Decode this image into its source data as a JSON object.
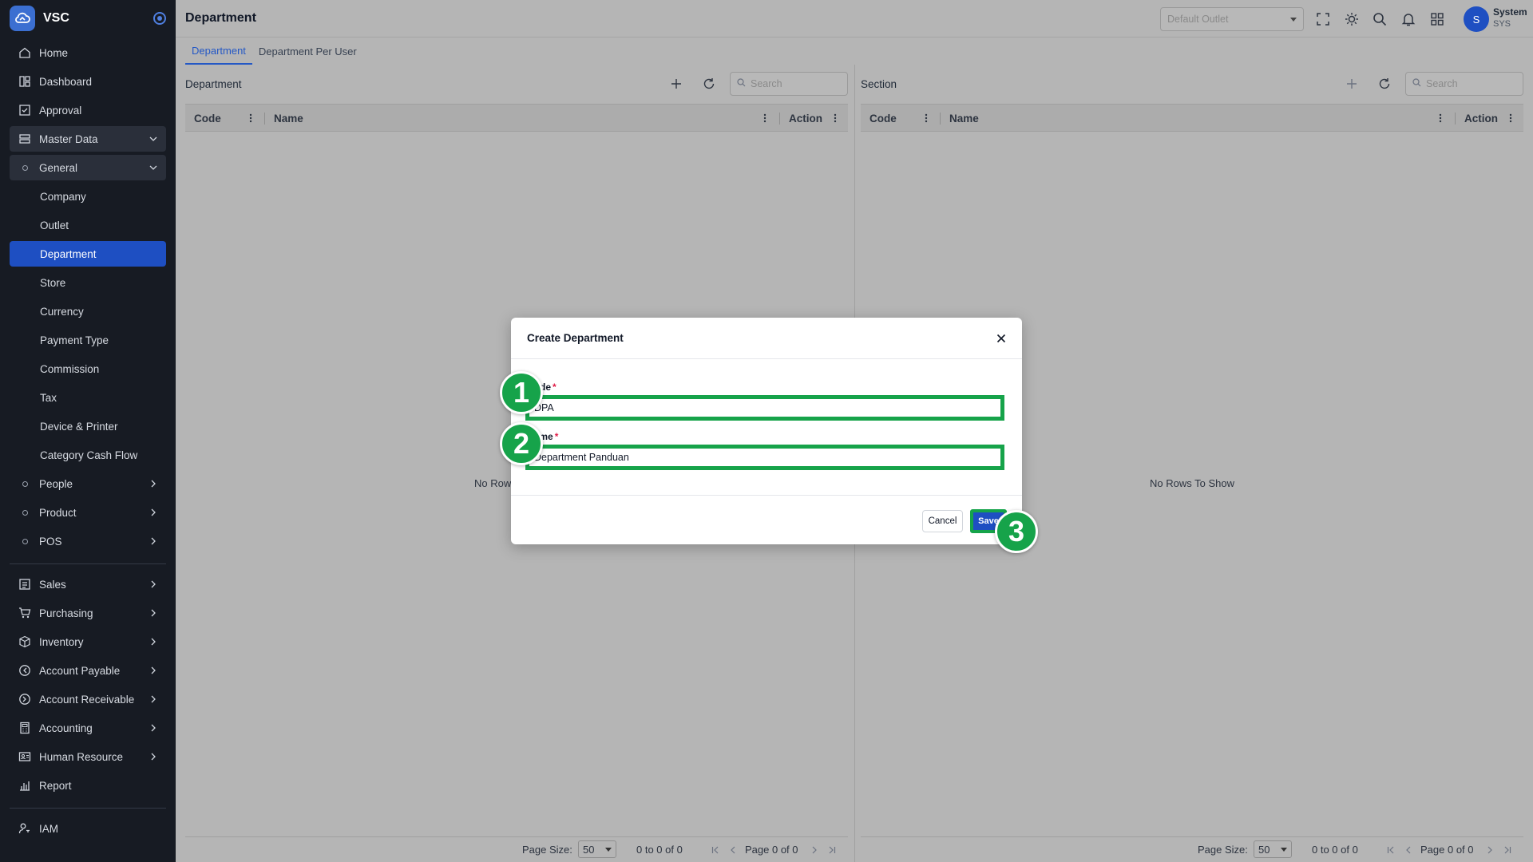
{
  "app": {
    "name": "VSC"
  },
  "sidebar": {
    "items": [
      {
        "label": "Home",
        "icon": "home-icon"
      },
      {
        "label": "Dashboard",
        "icon": "dashboard-icon"
      },
      {
        "label": "Approval",
        "icon": "approval-icon"
      },
      {
        "label": "Master Data",
        "icon": "master-data-icon"
      },
      {
        "label": "General"
      },
      {
        "label": "Company"
      },
      {
        "label": "Outlet"
      },
      {
        "label": "Department"
      },
      {
        "label": "Store"
      },
      {
        "label": "Currency"
      },
      {
        "label": "Payment Type"
      },
      {
        "label": "Commission"
      },
      {
        "label": "Tax"
      },
      {
        "label": "Device & Printer"
      },
      {
        "label": "Category Cash Flow"
      },
      {
        "label": "People"
      },
      {
        "label": "Product"
      },
      {
        "label": "POS"
      },
      {
        "label": "Sales",
        "icon": "sales-icon"
      },
      {
        "label": "Purchasing",
        "icon": "cart-icon"
      },
      {
        "label": "Inventory",
        "icon": "box-icon"
      },
      {
        "label": "Account Payable",
        "icon": "payable-icon"
      },
      {
        "label": "Account Receivable",
        "icon": "receivable-icon"
      },
      {
        "label": "Accounting",
        "icon": "calculator-icon"
      },
      {
        "label": "Human Resource",
        "icon": "id-card-icon"
      },
      {
        "label": "Report",
        "icon": "bar-chart-icon"
      },
      {
        "label": "IAM",
        "icon": "user-key-icon"
      }
    ]
  },
  "header": {
    "title": "Department",
    "outlet_placeholder": "Default Outlet",
    "user": {
      "initial": "S",
      "name": "System",
      "code": "SYS"
    }
  },
  "tabs": [
    {
      "label": "Department",
      "active": true
    },
    {
      "label": "Department Per User",
      "active": false
    }
  ],
  "department_panel": {
    "title": "Department",
    "search_placeholder": "Search",
    "columns": [
      "Code",
      "Name",
      "Action"
    ],
    "empty_text": "No Rows To Show",
    "page_size_label": "Page Size:",
    "page_size": "50",
    "range": "0 to 0 of 0",
    "page": "Page 0 of 0"
  },
  "section_panel": {
    "title": "Section",
    "search_placeholder": "Search",
    "columns": [
      "Code",
      "Name",
      "Action"
    ],
    "empty_text": "No Rows To Show",
    "page_size_label": "Page Size:",
    "page_size": "50",
    "range": "0 to 0 of 0",
    "page": "Page 0 of 0"
  },
  "modal": {
    "title": "Create Department",
    "code_label": "Code",
    "code_value": "DPA",
    "name_label": "Name",
    "name_value": "Department Panduan",
    "required_mark": "*",
    "cancel_label": "Cancel",
    "save_label": "Save"
  },
  "markers": [
    "1",
    "2",
    "3"
  ],
  "colors": {
    "accent": "#1e4fc2",
    "sidebar_bg": "#171b23",
    "highlight": "#16a34a",
    "required": "#e11d48"
  }
}
